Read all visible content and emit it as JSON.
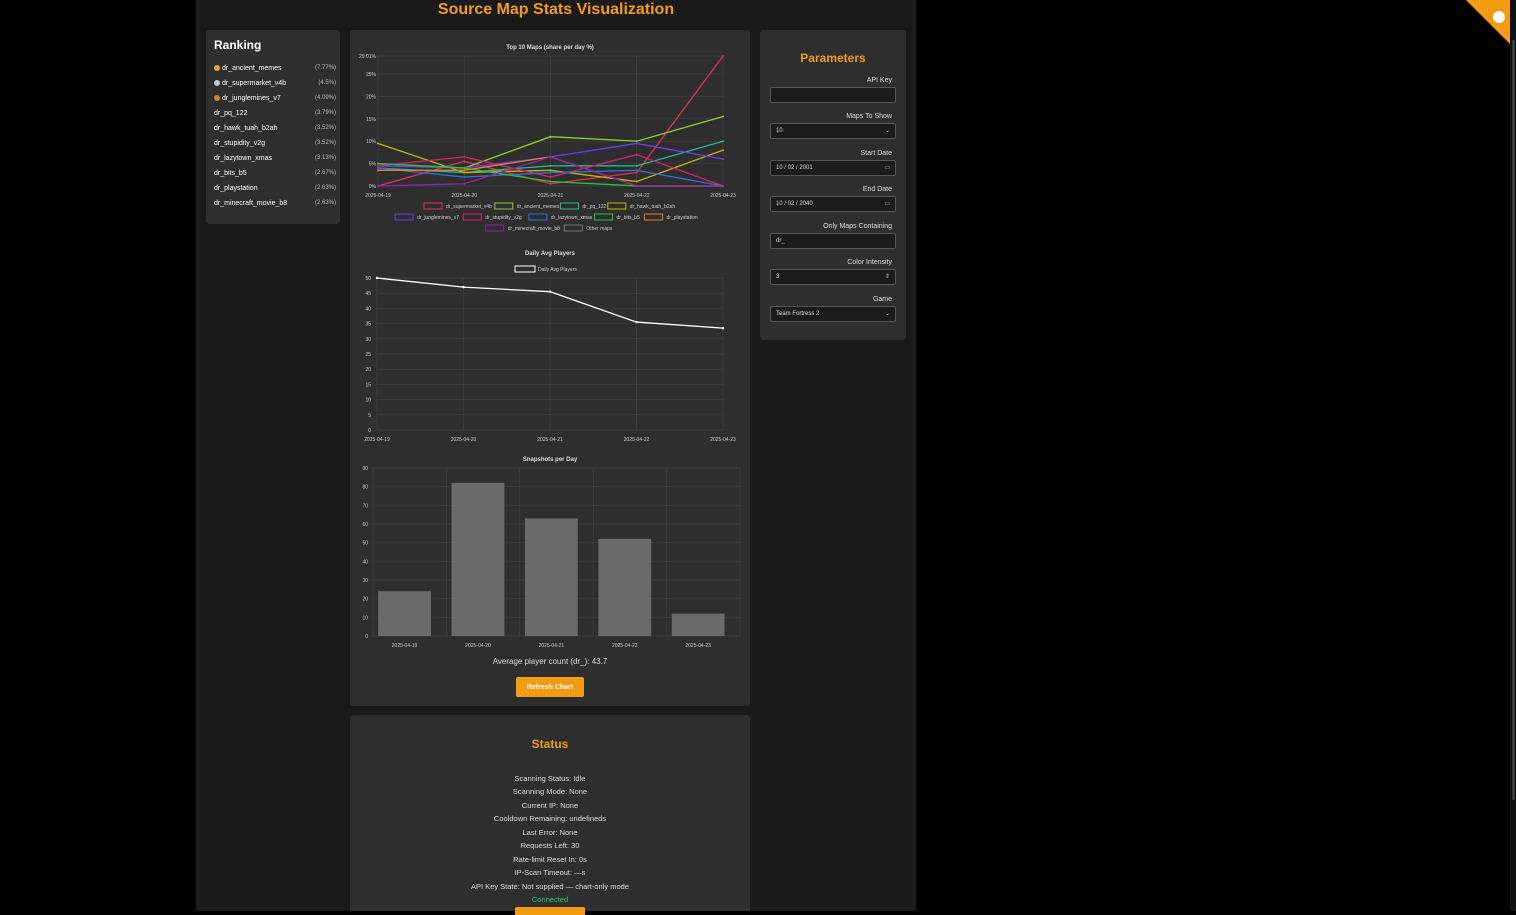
{
  "app": {
    "title": "Source Map Stats Visualization"
  },
  "ranking": {
    "title": "Ranking",
    "items": [
      {
        "name": "dr_ancient_memes",
        "share": "(7.77%)",
        "medal": "gold"
      },
      {
        "name": "dr_supermarket_v4b",
        "share": "(4.5%)",
        "medal": "silver"
      },
      {
        "name": "dr_junglemines_v7",
        "share": "(4.09%)",
        "medal": "bronze"
      },
      {
        "name": "dr_pq_122",
        "share": "(3.79%)",
        "medal": ""
      },
      {
        "name": "dr_hawk_tuah_b2ah",
        "share": "(3.52%)",
        "medal": ""
      },
      {
        "name": "dr_stupidity_v2g",
        "share": "(3.52%)",
        "medal": ""
      },
      {
        "name": "dr_lazytown_xmas",
        "share": "(3.13%)",
        "medal": ""
      },
      {
        "name": "dr_bits_b5",
        "share": "(2.67%)",
        "medal": ""
      },
      {
        "name": "dr_playstation",
        "share": "(2.63%)",
        "medal": ""
      },
      {
        "name": "dr_minecraft_movie_b8",
        "share": "(2.63%)",
        "medal": ""
      }
    ]
  },
  "chart_data": [
    {
      "type": "line",
      "title": "Top 10 Maps (share per day %)",
      "x": [
        "2025-04-19",
        "2025-04-20",
        "2025-04-21",
        "2025-04-22",
        "2025-04-23"
      ],
      "yticks": [
        "0%",
        "5%",
        "10%",
        "15%",
        "20%",
        "25%",
        "29.01%"
      ],
      "ylim": [
        0,
        29.01
      ],
      "legend_position": "bottom",
      "series": [
        {
          "name": "dr_supermarket_v4b",
          "color": "#e0314b",
          "values": [
            0,
            5.5,
            0.5,
            3,
            29
          ]
        },
        {
          "name": "dr_ancient_memes",
          "color": "#8ad426",
          "values": [
            5,
            4,
            11,
            10,
            15.5
          ]
        },
        {
          "name": "dr_pq_122",
          "color": "#1abc9c",
          "values": [
            4,
            3,
            4.5,
            4.5,
            10
          ]
        },
        {
          "name": "dr_hawk_tuah_b2ah",
          "color": "#c9b400",
          "values": [
            9.5,
            3,
            3.5,
            1,
            8
          ]
        },
        {
          "name": "dr_junglemines_v7",
          "color": "#6a3df0",
          "values": [
            4.5,
            4,
            6.5,
            9.5,
            6
          ]
        },
        {
          "name": "dr_stupidity_v2g",
          "color": "#d6226e",
          "values": [
            4.5,
            6.5,
            2,
            7,
            0
          ]
        },
        {
          "name": "dr_lazytown_xmas",
          "color": "#2f6fd6",
          "values": [
            4,
            2,
            3,
            3.5,
            0
          ]
        },
        {
          "name": "dr_bits_b5",
          "color": "#22c73a",
          "values": [
            5,
            4,
            1,
            0,
            0
          ]
        },
        {
          "name": "dr_playstation",
          "color": "#e67e22",
          "values": [
            3.5,
            3.5,
            6.5,
            0,
            0
          ]
        },
        {
          "name": "dr_minecraft_movie_b8",
          "color": "#8e24aa",
          "values": [
            0,
            0.5,
            6.5,
            0,
            0
          ]
        },
        {
          "name": "Other maps",
          "color": "#777777",
          "values": []
        }
      ]
    },
    {
      "type": "line",
      "title": "Daily Avg Players",
      "x": [
        "2025-04-19",
        "2025-04-20",
        "2025-04-21",
        "2025-04-22",
        "2025-04-23"
      ],
      "ylim": [
        0,
        50
      ],
      "yticks": [
        "0",
        "5",
        "10",
        "15",
        "20",
        "25",
        "30",
        "35",
        "40",
        "45",
        "50"
      ],
      "legend_position": "top",
      "series": [
        {
          "name": "Daily Avg Players",
          "color": "#ffffff",
          "values": [
            50,
            47,
            45.5,
            35.5,
            33.5
          ]
        }
      ]
    },
    {
      "type": "bar",
      "title": "Snapshots per Day",
      "categories": [
        "2025-04-19",
        "2025-04-20",
        "2025-04-21",
        "2025-04-22",
        "2025-04-23"
      ],
      "values": [
        24,
        82,
        63,
        52,
        12
      ],
      "ylim": [
        0,
        90
      ],
      "yticks": [
        "0",
        "10",
        "20",
        "30",
        "40",
        "50",
        "60",
        "70",
        "80",
        "90"
      ],
      "color": "#6a6a6a"
    }
  ],
  "chart_footer": {
    "avg_text": "Average player count (dr_): 43.7",
    "refresh_label": "Refresh Chart"
  },
  "status": {
    "title": "Status",
    "lines": [
      "Scanning Status: Idle",
      "Scanning Mode: None",
      "Current IP: None",
      "Cooldown Remaining: undefineds",
      "Last Error: None",
      "Requests Left: 30",
      "Rate-limit Reset In: 0s",
      "IP-Scan Timeout: —s",
      "API Key State: Not supplied — chart-only mode"
    ],
    "connection": "Connected"
  },
  "params": {
    "title": "Parameters",
    "api_key_label": "API Key",
    "api_key_value": "",
    "maps_label": "Maps To Show",
    "maps_value": "10",
    "start_label": "Start Date",
    "start_value": "10 / 02 / 2001",
    "end_label": "End Date",
    "end_value": "10 / 02 / 2040",
    "contains_label": "Only Maps Containing",
    "contains_value": "dr_",
    "intensity_label": "Color Intensity",
    "intensity_value": "3",
    "game_label": "Game",
    "game_value": "Team Fortress 2"
  },
  "theme": {
    "accent": "#f39c12",
    "card": "#2e2e2e",
    "background": "#000000"
  }
}
